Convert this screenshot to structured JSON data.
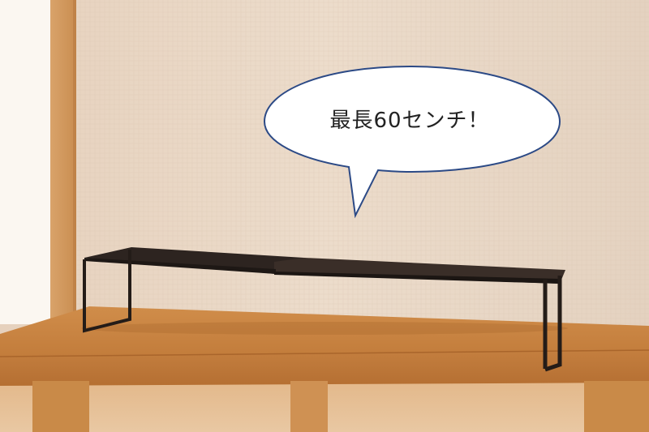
{
  "speech_bubble": {
    "text": "最長60センチ！"
  },
  "colors": {
    "wall": "#ead8c5",
    "wood": "#c9863f",
    "rack": "#2f2723",
    "bubble_outline": "#2c4a86"
  }
}
